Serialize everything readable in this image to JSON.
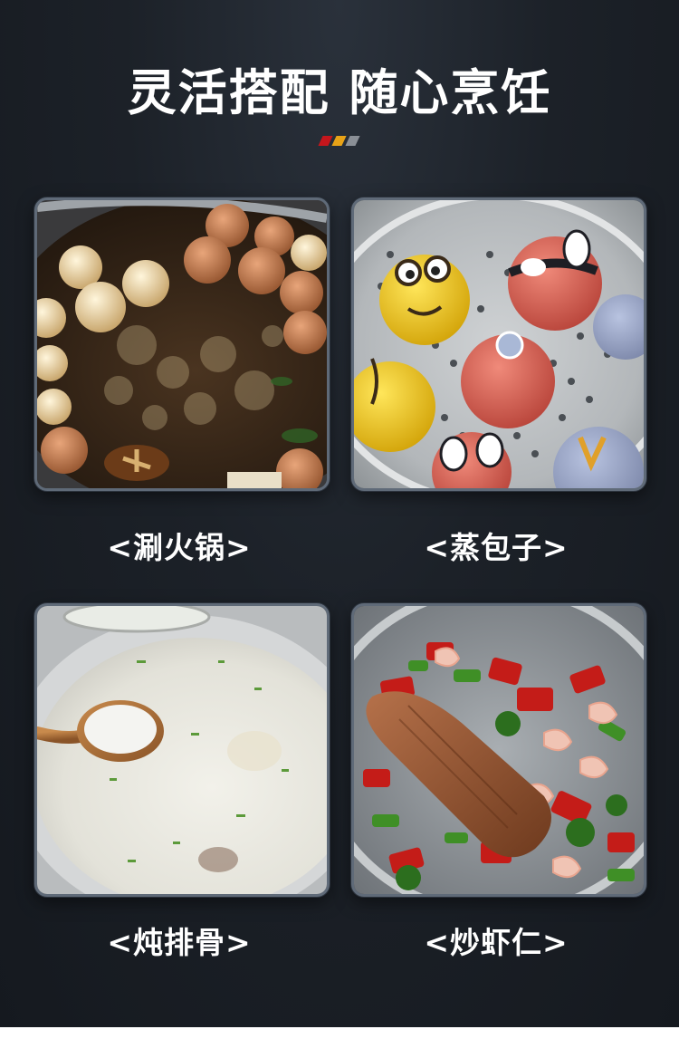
{
  "header": {
    "title": "灵活搭配 随心烹饪",
    "stripe_colors": [
      "#c4161c",
      "#e8a317",
      "#8a8f96"
    ]
  },
  "cards": [
    {
      "caption": "<涮火锅>",
      "image": "hotpot-photo"
    },
    {
      "caption": "<蒸包子>",
      "image": "steamed-buns-photo"
    },
    {
      "caption": "<炖排骨>",
      "image": "stewed-ribs-photo"
    },
    {
      "caption": "<炒虾仁>",
      "image": "stir-fried-shrimp-photo"
    }
  ]
}
